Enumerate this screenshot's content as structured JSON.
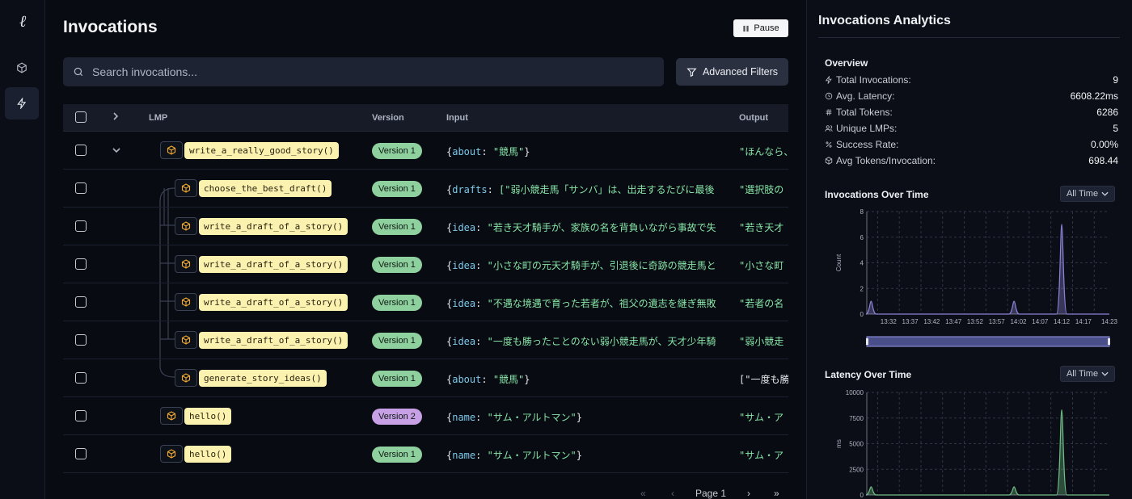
{
  "app": {
    "logo": "ℓ"
  },
  "sidebar": {
    "items": [
      {
        "icon": "cube-icon"
      },
      {
        "icon": "lightning-icon",
        "active": true
      }
    ]
  },
  "header": {
    "title": "Invocations",
    "pause_label": "Pause"
  },
  "search": {
    "placeholder": "Search invocations...",
    "filters_label": "Advanced Filters"
  },
  "table": {
    "columns": {
      "lmp": "LMP",
      "version": "Version",
      "input": "Input",
      "output": "Output"
    },
    "rows": [
      {
        "lmp": "write_a_really_good_story()",
        "version": "Version 1",
        "input_key": "about",
        "input_val": "\"競馬\"",
        "input_close": "}",
        "output": "\"ほんなら、"
      },
      {
        "lmp": "choose_the_best_draft()",
        "version": "Version 1",
        "input_key": "drafts",
        "input_val": "[\"弱小競走馬「サンバ」は、出走するたびに最後",
        "input_close": "",
        "output": "\"選択肢の"
      },
      {
        "lmp": "write_a_draft_of_a_story()",
        "version": "Version 1",
        "input_key": "idea",
        "input_val": "\"若き天才騎手が、家族の名を背負いながら事故で失",
        "input_close": "",
        "output": "\"若き天才"
      },
      {
        "lmp": "write_a_draft_of_a_story()",
        "version": "Version 1",
        "input_key": "idea",
        "input_val": "\"小さな町の元天才騎手が、引退後に奇跡の競走馬と",
        "input_close": "",
        "output": "\"小さな町"
      },
      {
        "lmp": "write_a_draft_of_a_story()",
        "version": "Version 1",
        "input_key": "idea",
        "input_val": "\"不遇な境遇で育った若者が、祖父の遺志を継ぎ無敗",
        "input_close": "",
        "output": "\"若者の名"
      },
      {
        "lmp": "write_a_draft_of_a_story()",
        "version": "Version 1",
        "input_key": "idea",
        "input_val": "\"一度も勝ったことのない弱小競走馬が、天才少年騎",
        "input_close": "",
        "output": "\"弱小競走"
      },
      {
        "lmp": "generate_story_ideas()",
        "version": "Version 1",
        "input_key": "about",
        "input_val": "\"競馬\"",
        "input_close": "}",
        "output": "[\"一度も勝"
      },
      {
        "lmp": "hello()",
        "version": "Version 2",
        "input_key": "name",
        "input_val": "\"サム・アルトマン\"",
        "input_close": "}",
        "output": "\"サム・ア"
      },
      {
        "lmp": "hello()",
        "version": "Version 1",
        "input_key": "name",
        "input_val": "\"サム・アルトマン\"",
        "input_close": "}",
        "output": "\"サム・ア"
      }
    ]
  },
  "pager": {
    "first": "«",
    "prev": "‹",
    "page_label": "Page 1",
    "next": "›",
    "last": "»"
  },
  "analytics": {
    "title": "Invocations Analytics",
    "overview_title": "Overview",
    "stats": [
      {
        "label": "Total Invocations:",
        "value": "9",
        "icon": "lightning-icon"
      },
      {
        "label": "Avg. Latency:",
        "value": "6608.22ms",
        "icon": "clock-icon"
      },
      {
        "label": "Total Tokens:",
        "value": "6286",
        "icon": "hash-icon"
      },
      {
        "label": "Unique LMPs:",
        "value": "5",
        "icon": "users-icon"
      },
      {
        "label": "Success Rate:",
        "value": "0.00%",
        "icon": "percent-icon"
      },
      {
        "label": "Avg Tokens/Invocation:",
        "value": "698.44",
        "icon": "cube-icon"
      }
    ],
    "invocations_title": "Invocations Over Time",
    "latency_title": "Latency Over Time",
    "range_option": "All Time"
  },
  "chart_data": [
    {
      "type": "area",
      "title": "Invocations Over Time",
      "ylabel": "Count",
      "ylim": [
        0,
        8
      ],
      "yticks": [
        0,
        2,
        4,
        6,
        8
      ],
      "x_ticks": [
        "13:32",
        "13:37",
        "13:42",
        "13:47",
        "13:52",
        "13:57",
        "14:02",
        "14:07",
        "14:12",
        "14:17",
        "14:23"
      ],
      "series": [
        {
          "color": "#8b82d6",
          "points": [
            {
              "x": "13:28",
              "y": 1
            },
            {
              "x": "14:01",
              "y": 1
            },
            {
              "x": "14:12",
              "y": 7
            }
          ]
        }
      ]
    },
    {
      "type": "area",
      "title": "Latency Over Time",
      "ylabel": "ms",
      "ylim": [
        0,
        10000
      ],
      "yticks": [
        0,
        2500,
        5000,
        7500,
        10000
      ],
      "series": [
        {
          "color": "#6fbf85",
          "points": [
            {
              "x": "13:28",
              "y": 800
            },
            {
              "x": "14:01",
              "y": 800
            },
            {
              "x": "14:12",
              "y": 8300
            }
          ]
        }
      ]
    }
  ]
}
